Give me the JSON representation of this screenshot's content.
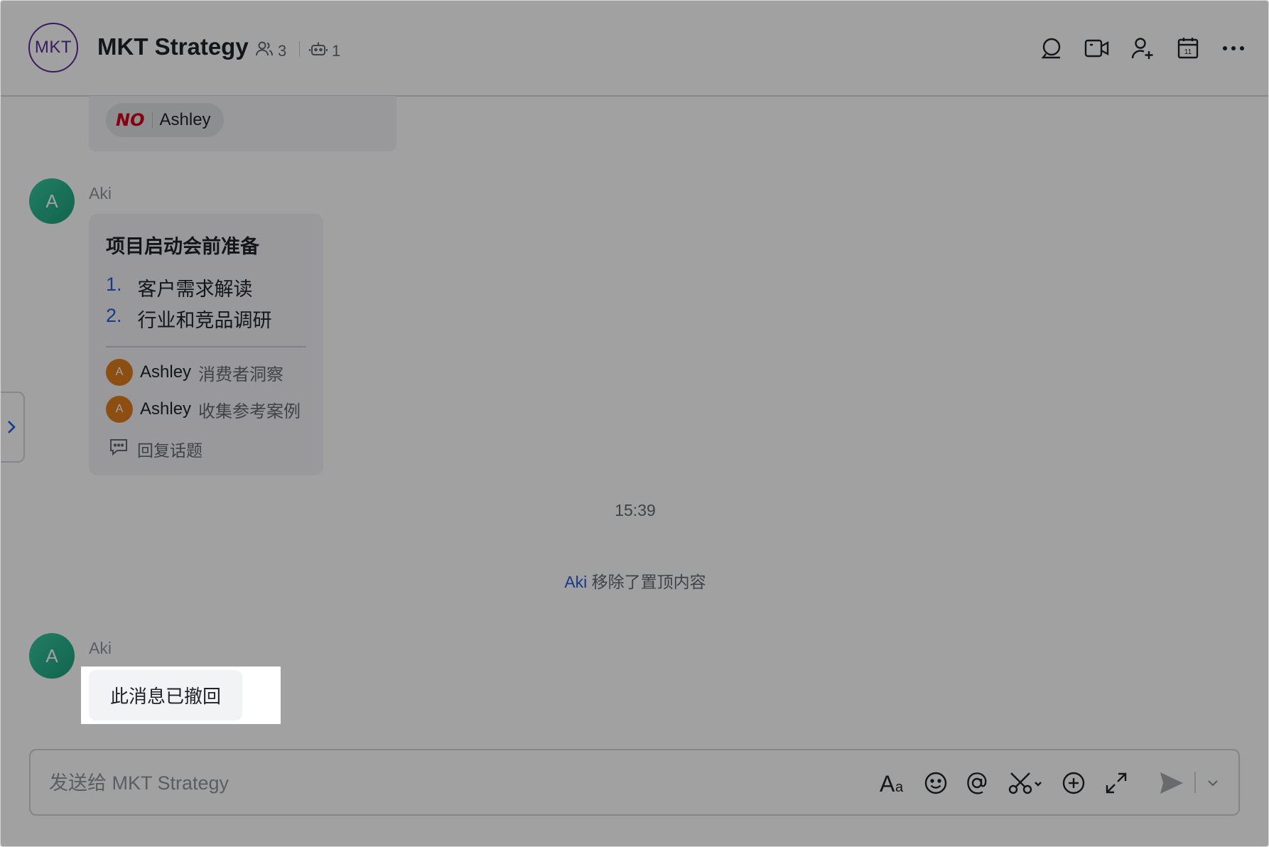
{
  "header": {
    "avatar_text": "MKT",
    "title": "MKT Strategy",
    "member_count": "3",
    "bot_count": "1"
  },
  "pinned": {
    "reaction_emoji": "NO",
    "reaction_user": "Ashley"
  },
  "messages": [
    {
      "avatar_letter": "A",
      "sender": "Aki",
      "topic": {
        "title": "项目启动会前准备",
        "items": [
          {
            "num": "1.",
            "text": "客户需求解读"
          },
          {
            "num": "2.",
            "text": "行业和竞品调研"
          }
        ],
        "replies": [
          {
            "avatar_letter": "A",
            "name": "Ashley",
            "text": "消费者洞察"
          },
          {
            "avatar_letter": "A",
            "name": "Ashley",
            "text": "收集参考案例"
          }
        ],
        "reply_topic_label": "回复话题"
      }
    },
    {
      "avatar_letter": "A",
      "sender": "Aki",
      "recalled_text": "此消息已撤回"
    }
  ],
  "timestamp": "15:39",
  "system_message": {
    "name": "Aki",
    "text": "移除了置顶内容"
  },
  "composer": {
    "placeholder": "发送给 MKT Strategy"
  },
  "colors": {
    "group_avatar": "#5b2c9a",
    "user_avatar": "#1aa07a",
    "reply_avatar": "#e07c1d",
    "accent": "#245bdb",
    "reaction": "#d0021b"
  }
}
